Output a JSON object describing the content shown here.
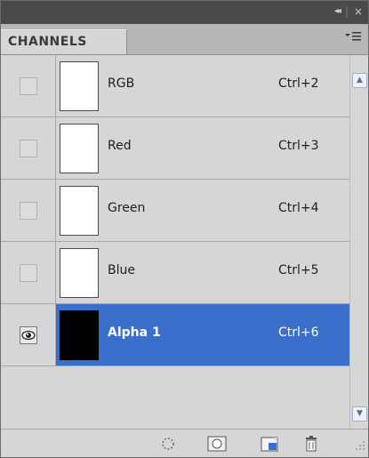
{
  "panel": {
    "title_controls": {
      "collapse": "◂◂",
      "close": "×"
    },
    "tab_label": "CHANNELS",
    "menu_icon": "panel-menu-icon"
  },
  "channels": [
    {
      "name": "RGB",
      "shortcut": "Ctrl+2",
      "visible": false,
      "selected": false,
      "thumb": "white"
    },
    {
      "name": "Red",
      "shortcut": "Ctrl+3",
      "visible": false,
      "selected": false,
      "thumb": "white"
    },
    {
      "name": "Green",
      "shortcut": "Ctrl+4",
      "visible": false,
      "selected": false,
      "thumb": "white"
    },
    {
      "name": "Blue",
      "shortcut": "Ctrl+5",
      "visible": false,
      "selected": false,
      "thumb": "white"
    },
    {
      "name": "Alpha 1",
      "shortcut": "Ctrl+6",
      "visible": true,
      "selected": true,
      "thumb": "black"
    }
  ],
  "colors": {
    "selection": "#3a6fcc",
    "panel_bg": "#d6d6d6",
    "title_bg": "#4a4a4a"
  },
  "toolbar": {
    "buttons": [
      "load-selection-icon",
      "save-selection-icon",
      "new-channel-icon",
      "delete-channel-icon"
    ]
  }
}
